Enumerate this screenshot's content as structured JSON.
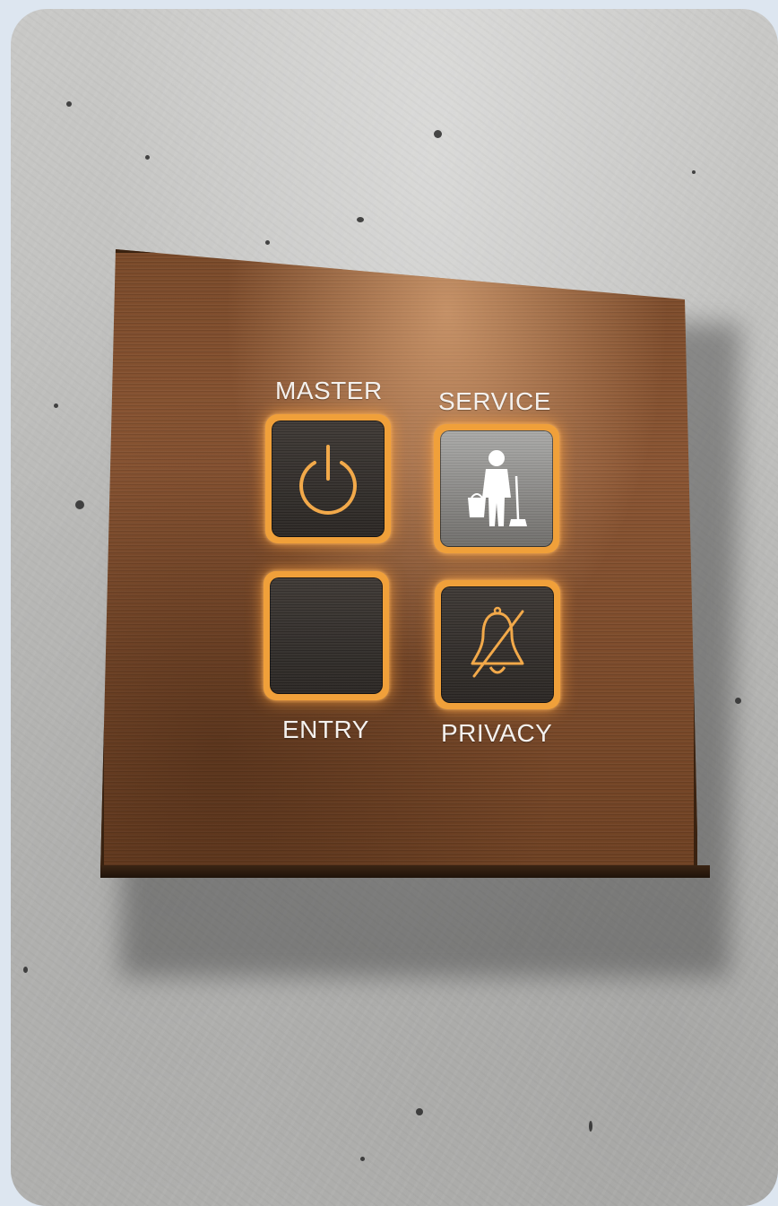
{
  "scene": "hotel room door control panel mounted on concrete wall",
  "panel": {
    "finish_color": "#7a4a2a",
    "accent_glow": "#f0a03a"
  },
  "buttons": [
    {
      "label": "MASTER",
      "icon": "power-icon",
      "lit": false
    },
    {
      "label": "SERVICE",
      "icon": "housekeeping-icon",
      "lit": true
    },
    {
      "label": "ENTRY",
      "icon": "none",
      "lit": false
    },
    {
      "label": "PRIVACY",
      "icon": "bell-off-icon",
      "lit": false
    }
  ]
}
